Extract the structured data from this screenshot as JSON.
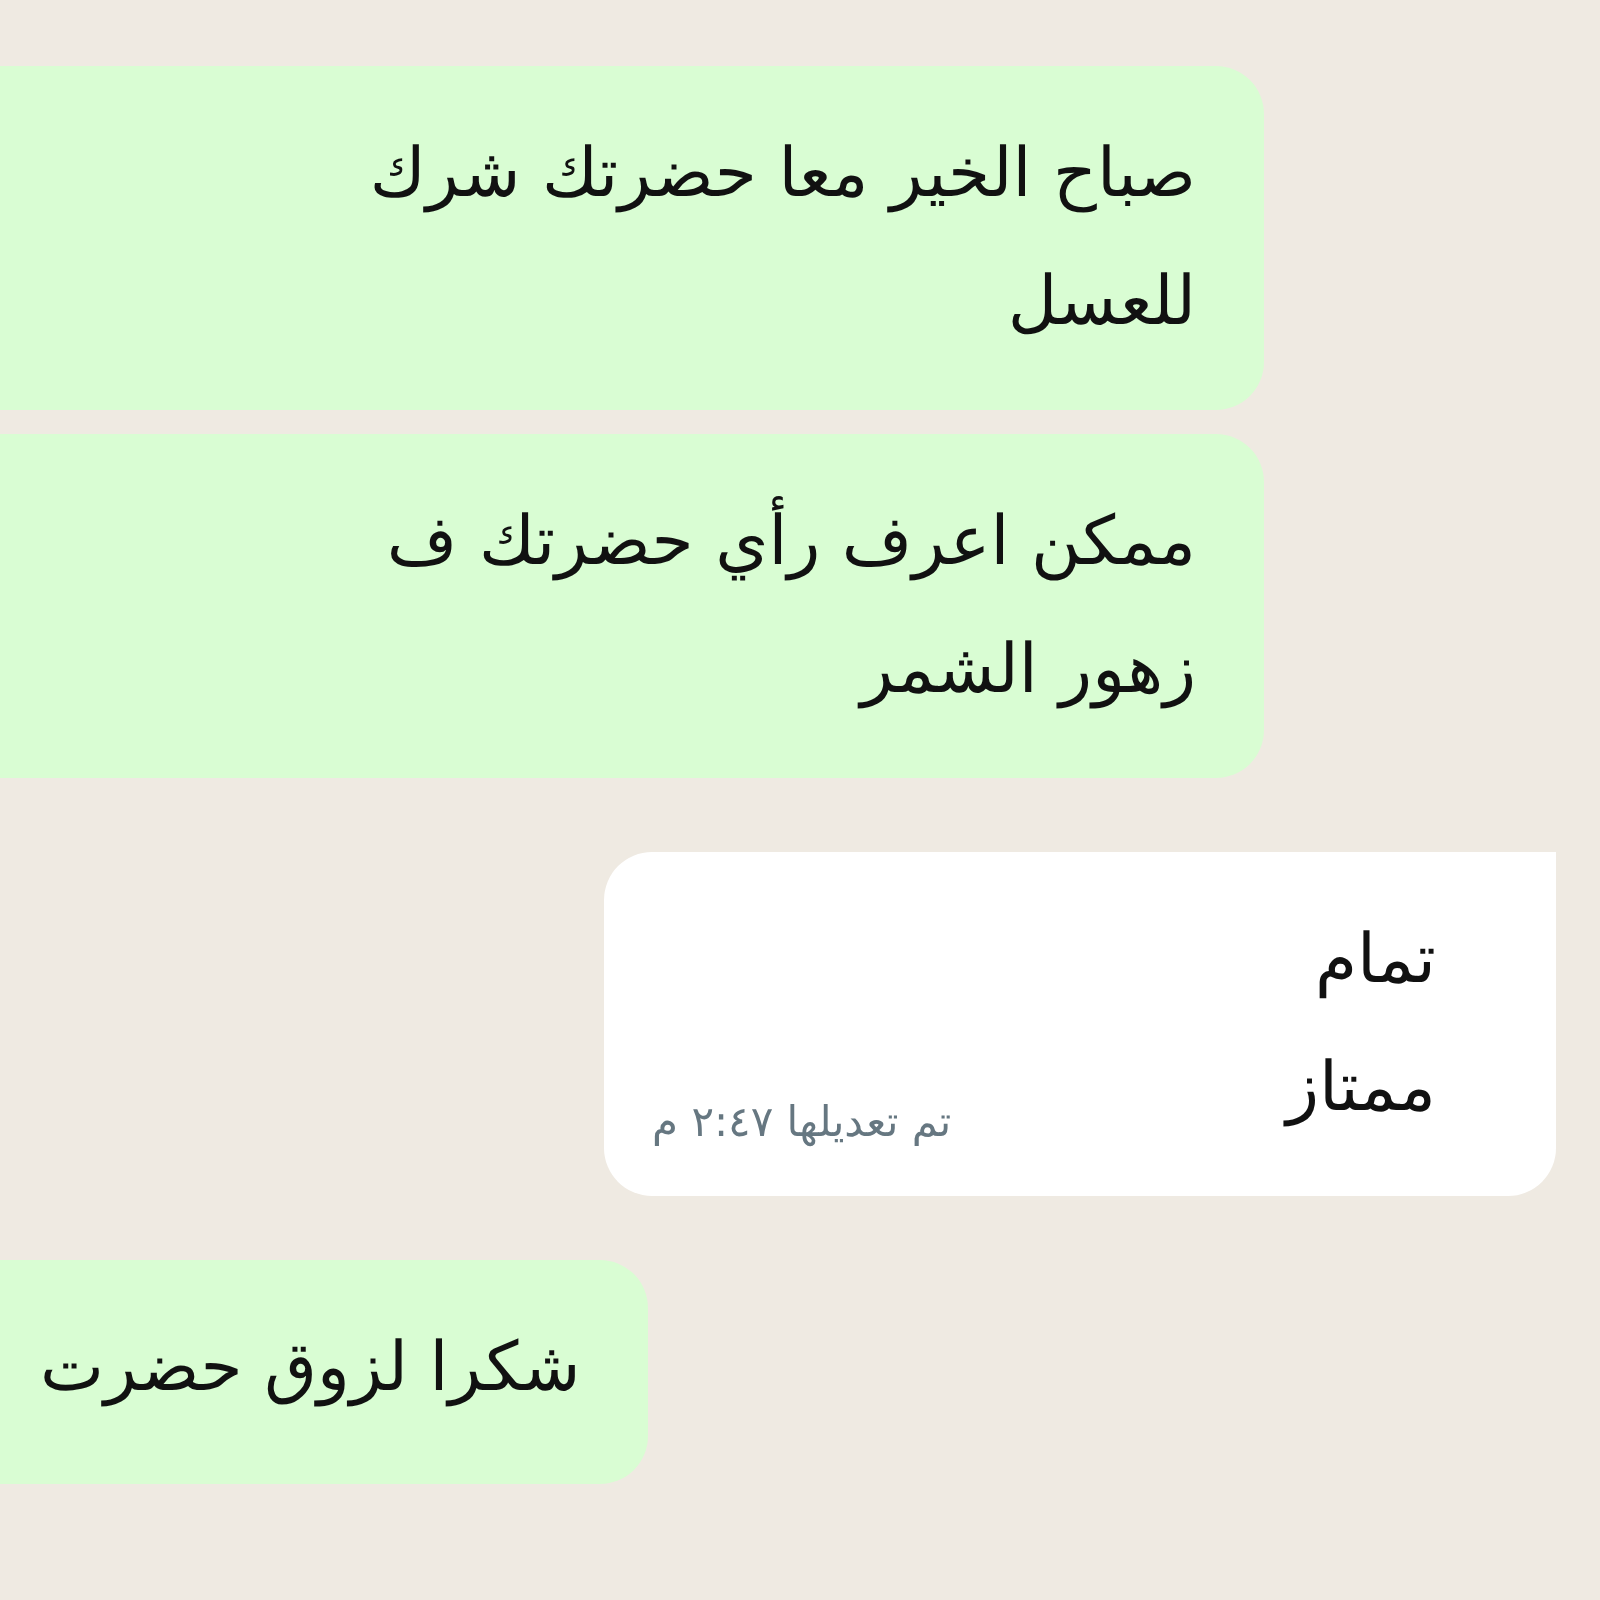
{
  "messages": [
    {
      "kind": "outgoing",
      "lines": [
        "صباح الخير معا حضرتك شرك",
        "للعسل"
      ]
    },
    {
      "kind": "outgoing",
      "lines": [
        "ممكن اعرف رأي حضرتك ف",
        "زهور الشمر"
      ]
    },
    {
      "kind": "incoming",
      "lines": [
        "تمام",
        "ممتاز"
      ],
      "meta": "تم تعديلها ٢:٤٧ م"
    },
    {
      "kind": "outgoing",
      "lines": [
        "شكرا لزوق حضرت"
      ]
    }
  ]
}
